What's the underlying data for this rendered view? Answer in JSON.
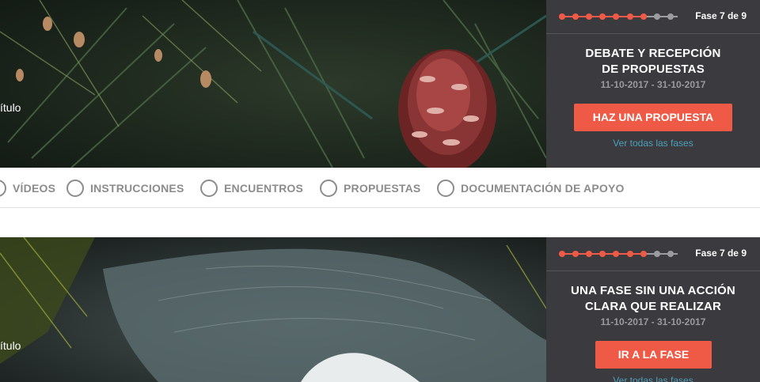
{
  "cards": [
    {
      "title_fragment": "ítulo",
      "phase_label": "Fase 7 de 9",
      "phase_total": 9,
      "phase_current": 7,
      "phase_name": "DEBATE Y RECEPCIÓN DE PROPUESTAS",
      "phase_name_lines": [
        "DEBATE Y RECEPCIÓN",
        "DE PROPUESTAS"
      ],
      "dates": "11-10-2017 - 31-10-2017",
      "cta_label": "HAZ UNA PROPUESTA",
      "all_phases_link": "Ver todas las fases"
    },
    {
      "title_fragment": "ítulo",
      "phase_label": "Fase 7 de 9",
      "phase_total": 9,
      "phase_current": 7,
      "phase_name_lines": [
        "UNA FASE SIN UNA ACCIÓN",
        "CLARA QUE REALIZAR"
      ],
      "dates": "11-10-2017 - 31-10-2017",
      "cta_label": "IR A LA FASE",
      "all_phases_link": "Ver todas las fases"
    }
  ],
  "tabs": [
    {
      "label": "VÍDEOS"
    },
    {
      "label": "INSTRUCCIONES"
    },
    {
      "label": "ENCUENTROS"
    },
    {
      "label": "PROPUESTAS"
    },
    {
      "label": "DOCUMENTACIÓN DE APOYO"
    }
  ],
  "colors": {
    "accent": "#ef5a47",
    "panel": "#3b3b3f",
    "link": "#4d9fb7",
    "tab_text": "#8c8c8c",
    "dot_inactive": "#9b9ba0"
  }
}
